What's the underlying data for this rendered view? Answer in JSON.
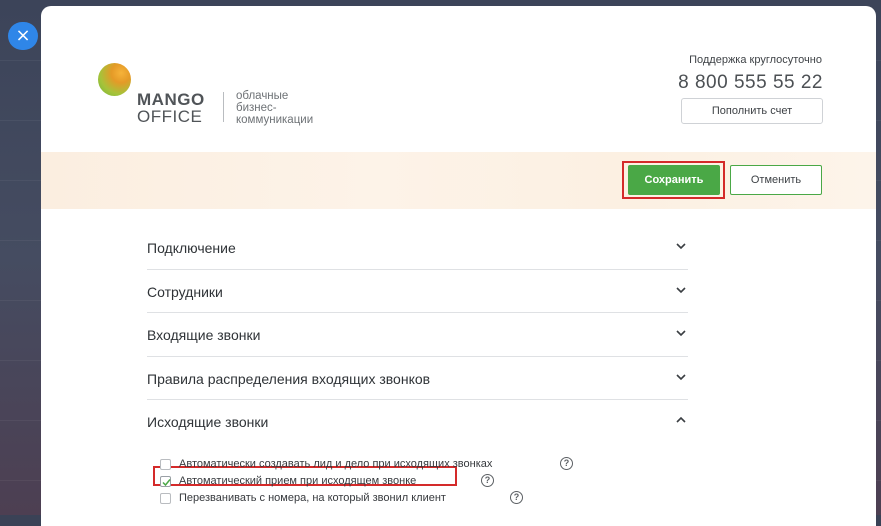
{
  "window": {
    "close_icon": "×"
  },
  "brand": {
    "logo_line1": "MANGO",
    "logo_line2": "OFFICE",
    "tagline": [
      "облачные",
      "бизнес-",
      "коммуникации"
    ]
  },
  "support": {
    "label": "Поддержка круглосуточно",
    "phone": "8 800 555 55 22",
    "topup_label": "Пополнить счет"
  },
  "actions": {
    "save_label": "Сохранить",
    "cancel_label": "Отменить"
  },
  "sections": [
    {
      "label": "Подключение",
      "expanded": false
    },
    {
      "label": "Сотрудники",
      "expanded": false
    },
    {
      "label": "Входящие звонки",
      "expanded": false
    },
    {
      "label": "Правила распределения входящих звонков",
      "expanded": false
    },
    {
      "label": "Исходящие звонки",
      "expanded": true
    }
  ],
  "outgoing_options": [
    {
      "label": "Автоматически создавать лид и дело при исходящих звонках",
      "checked": false,
      "help": "?"
    },
    {
      "label": "Автоматический прием при исходящем звонке",
      "checked": true,
      "help": "?"
    },
    {
      "label": "Перезванивать с номера, на который звонил клиент",
      "checked": false,
      "help": "?"
    }
  ],
  "colors": {
    "accent_green": "#4aa846",
    "highlight_red": "#d42a2a",
    "close_blue": "#2f86e8"
  }
}
